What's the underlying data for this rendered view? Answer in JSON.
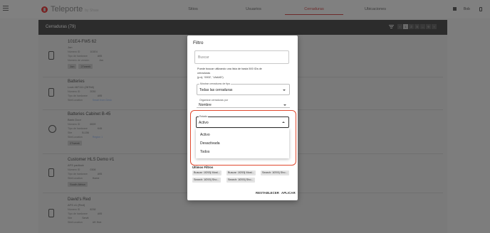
{
  "app": {
    "name": "Teleporte",
    "sub": "by Shaw"
  },
  "nav": {
    "tabs": [
      "Sitios",
      "Usuarios",
      "Cerraduras",
      "Ubicaciones"
    ],
    "active": "Cerraduras"
  },
  "header_right": {
    "user_label": "Bob"
  },
  "list": {
    "title": "Cerraduras (79)",
    "pages": [
      "1",
      "2",
      "3",
      "...",
      "9"
    ],
    "rows": [
      {
        "name": "101E4-FW5 62",
        "sub": "Jon",
        "details": [
          [
            "Número ID",
            "101E4"
          ],
          [
            "Tipo de hardware",
            "A95"
          ],
          [
            "Número de versión",
            "Jon"
          ]
        ],
        "tags": [
          "Jon",
          "27week"
        ]
      },
      {
        "name": "Batteries",
        "sub": "Lock 487111 (287bit)",
        "details": [
          [
            "Número ID",
            "2030"
          ],
          [
            "Tipo de hardware",
            "A95"
          ],
          [
            "Site/Location",
            "Smart from Desk"
          ]
        ],
        "tags": []
      },
      {
        "name": "Batteries Cabinet B-45",
        "sub": "Bank Door",
        "details": [
          [
            "Número ID",
            "6009"
          ],
          [
            "Tipo de hardware",
            "K45"
          ],
          [
            "Site",
            "B-156"
          ],
          [
            "Site/Location",
            "Region 1"
          ]
        ],
        "tags": [
          "27week"
        ]
      },
      {
        "name": "Customer HLS Demo #1",
        "sub": "AFS padlock",
        "details": [
          [
            "Número ID",
            "0308"
          ],
          [
            "Tipo de hardware",
            "A95"
          ],
          [
            "Site/Location",
            "Home"
          ]
        ],
        "tags": [
          "South Africa"
        ]
      },
      {
        "name": "David's Red",
        "sub": "AFS v1 (Red)",
        "details": [
          [
            "Número ID",
            "8238"
          ],
          [
            "Tipo de hardware",
            "A95"
          ],
          [
            "Site",
            "Servit"
          ],
          [
            "Site/Location",
            "UK Hub"
          ]
        ],
        "tags": []
      }
    ]
  },
  "dialog": {
    "title": "Filtro",
    "search_placeholder": "Buscar",
    "helper_lines": [
      "Puede buscar utilizando una lista de hasta 500 IDs de",
      "cerraduras",
      "(p.ej. '0002', '1AAAD')"
    ],
    "type_field": {
      "label": "Mostrar cerraduras de tipo",
      "value": "Todas las cerraduras"
    },
    "sort_field": {
      "label": "Organizar cerraduras por",
      "value": "Nombre"
    },
    "estado_field": {
      "label": "Estado",
      "value": "Activo"
    },
    "estado_options": [
      "Activo",
      "Desactivada",
      "Todos"
    ],
    "last_filters_title": "Últimos Filtros",
    "last_filters": [
      "Buscar: 1f293| Most...",
      "Buscar: 1f293| Most...",
      "Search: 1f293| Sho...",
      "Search: 1f293| Sho...",
      "Search: 1f293| Sho..."
    ],
    "reset_label": "RESTABLECER",
    "apply_label": "APLICAR"
  },
  "colors": {
    "accent": "#6e2b2b",
    "highlight": "#e0492e",
    "overlay": "#7d7d7d"
  }
}
